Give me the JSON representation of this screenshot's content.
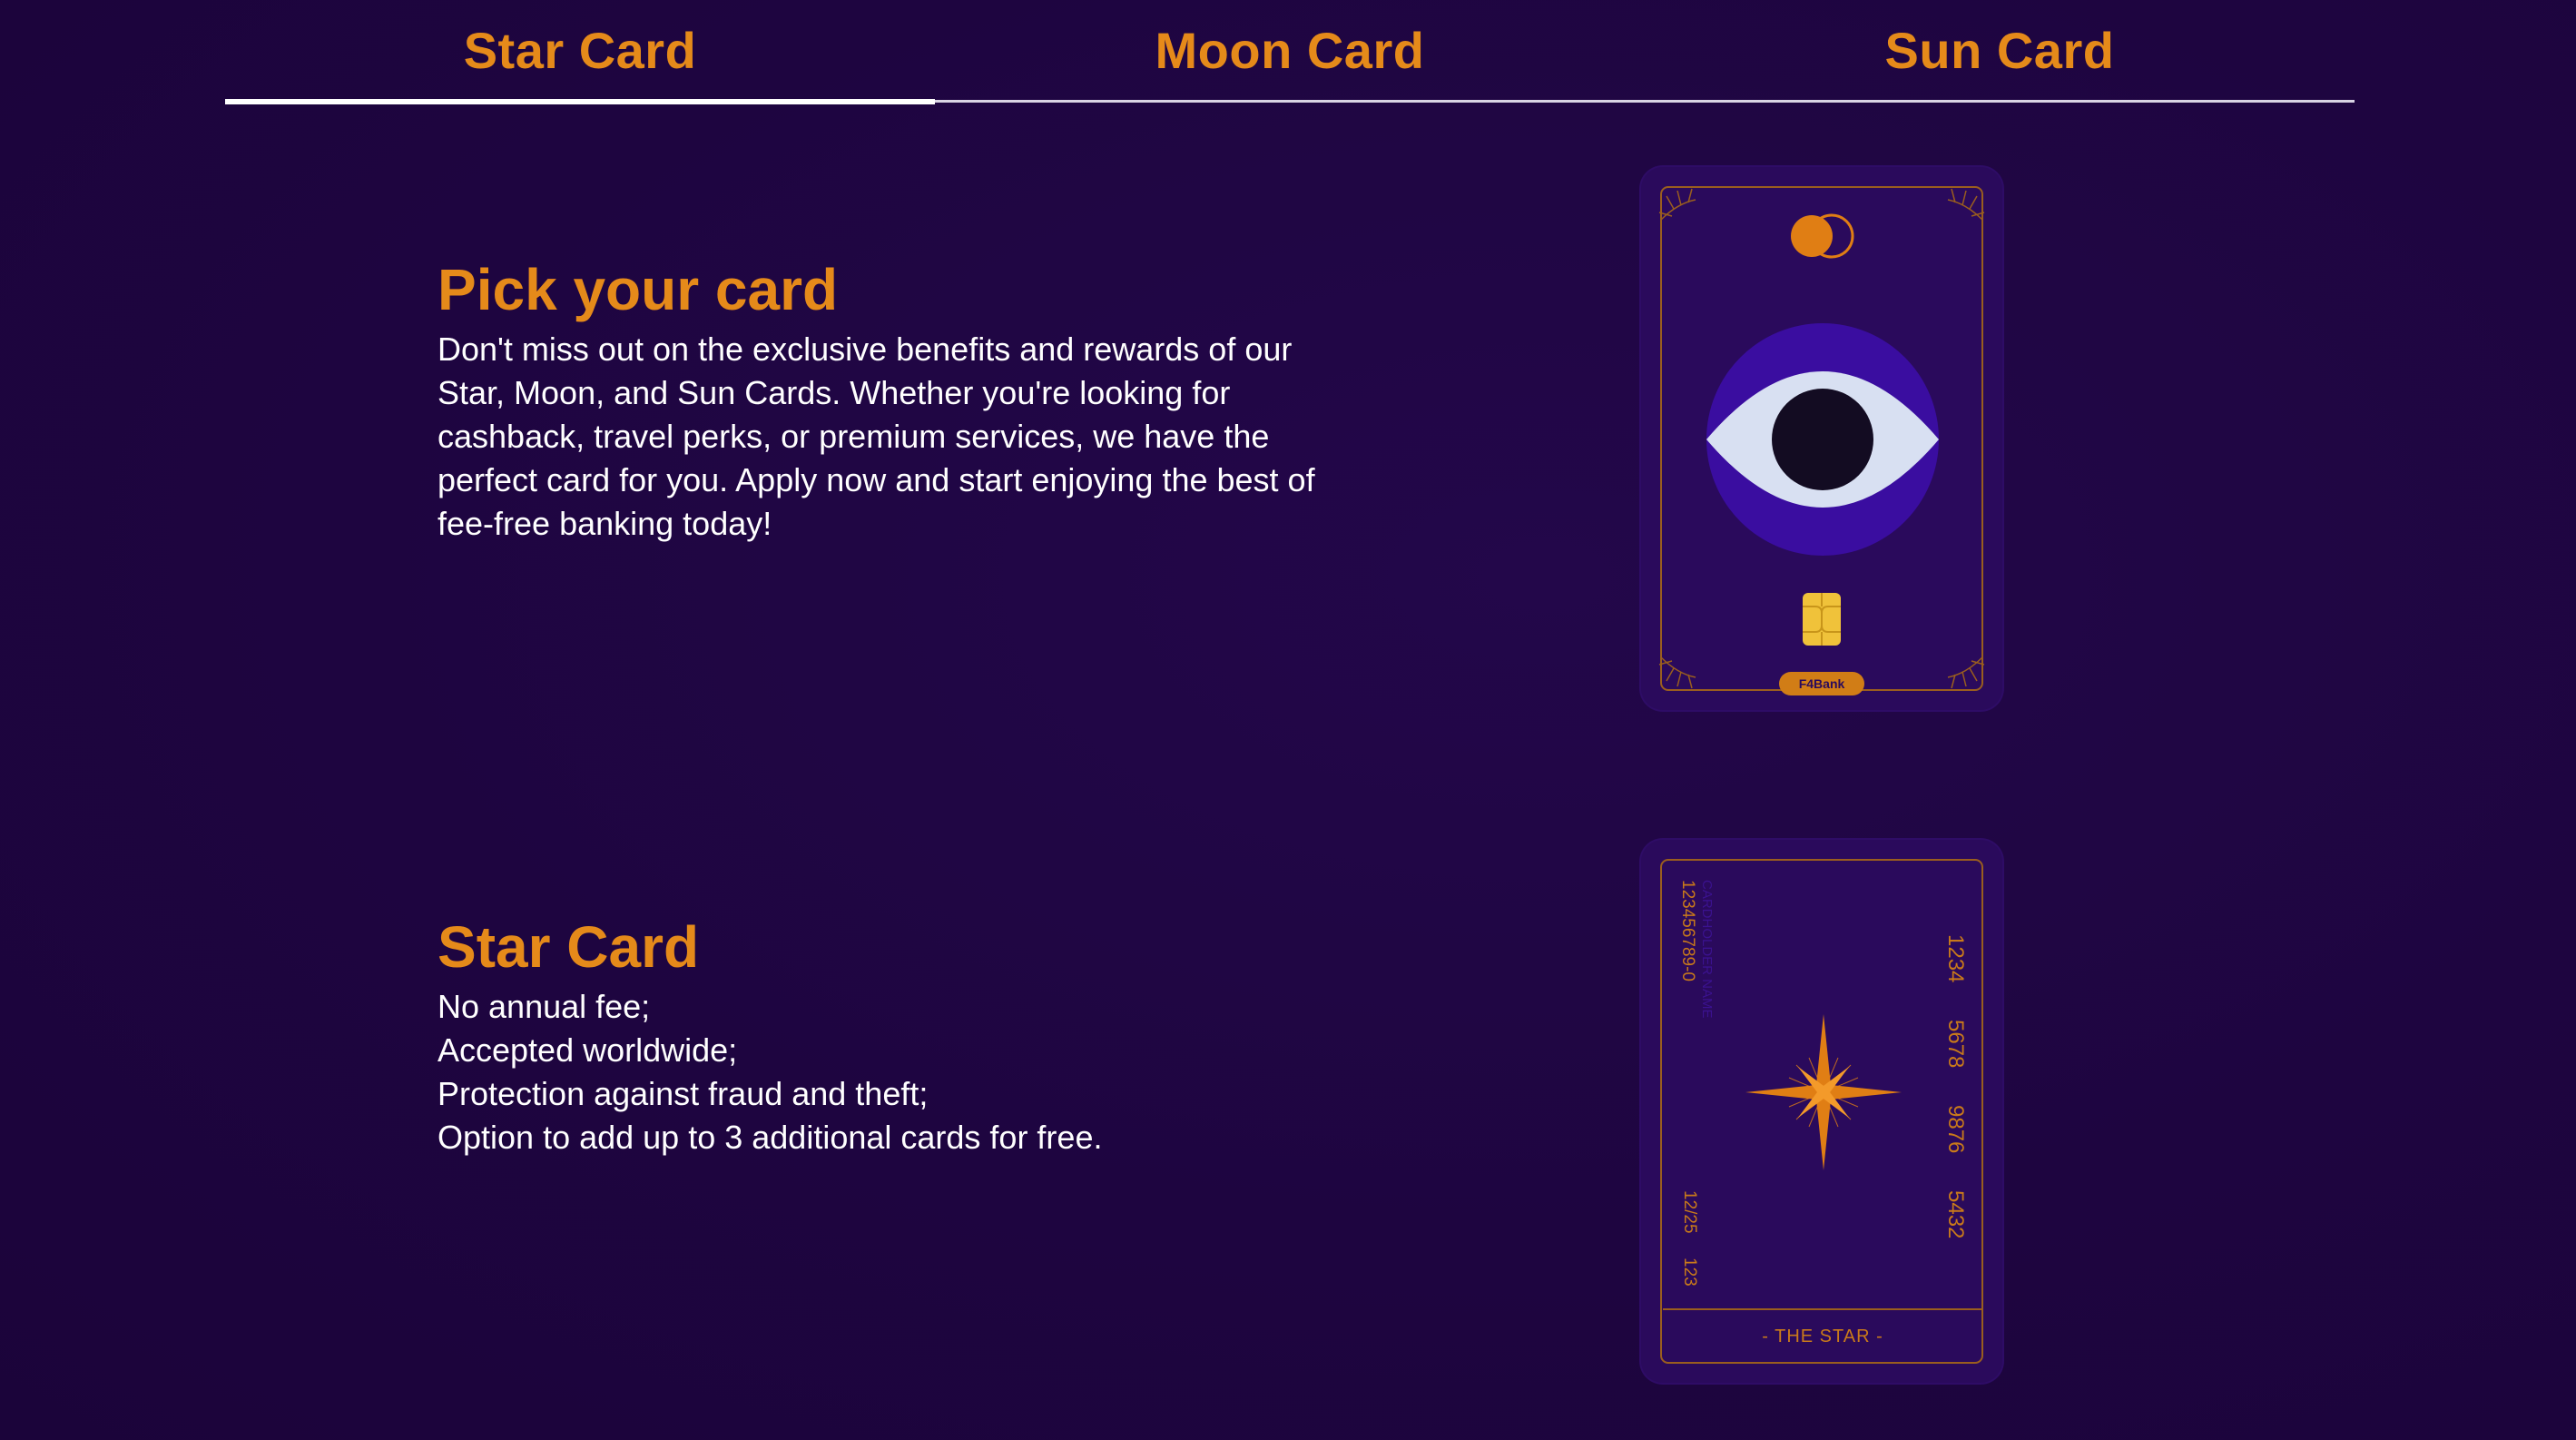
{
  "tabs": [
    {
      "label": "Star Card",
      "active": true
    },
    {
      "label": "Moon Card",
      "active": false
    },
    {
      "label": "Sun Card",
      "active": false
    }
  ],
  "intro": {
    "heading": "Pick your card",
    "body": "Don't miss out on the exclusive benefits and rewards of our Star, Moon, and Sun Cards. Whether you're looking for cashback, travel perks, or premium services, we have the perfect card for you. Apply now and start enjoying the best of fee-free banking today!"
  },
  "card_details": {
    "heading": "Star Card",
    "features": [
      "No annual fee;",
      "Accepted worldwide;",
      "Protection against fraud and theft;",
      "Option to add up to 3 additional cards for free."
    ]
  },
  "card_front": {
    "bank_label": "F4Bank"
  },
  "card_back": {
    "account_number": "123456789-0",
    "holder_label": "CARDHOLDER NAME",
    "expiry": "12/25",
    "cvv": "123",
    "number_groups": [
      "1234",
      "5678",
      "9876",
      "5432"
    ],
    "footer": "- THE STAR -"
  },
  "colors": {
    "background": "#1e0540",
    "accent": "#e58a1a",
    "text": "#ffffff",
    "card": "#2a0a5c"
  }
}
